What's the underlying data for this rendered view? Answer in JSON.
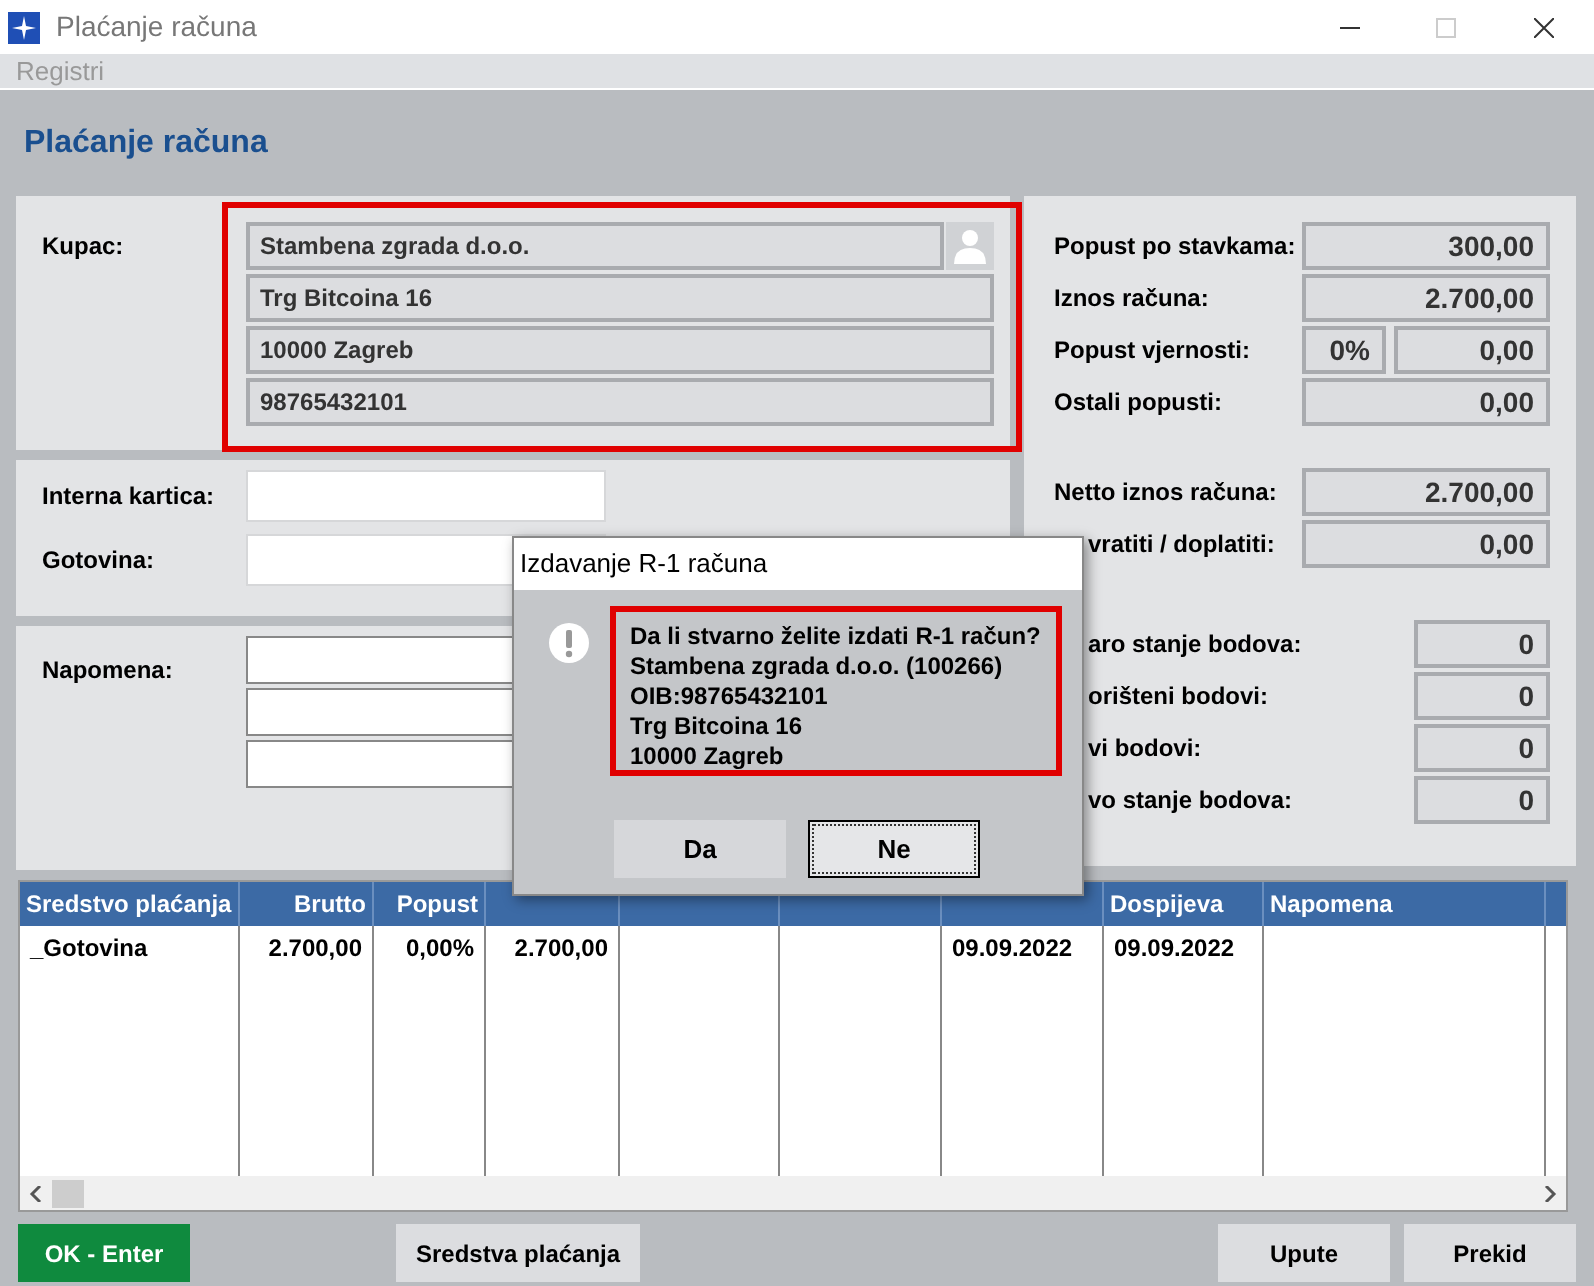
{
  "window": {
    "title": "Plaćanje računa"
  },
  "menu": [
    {
      "label": "Registri",
      "disabled": true
    }
  ],
  "heading": "Plaćanje računa",
  "customer": {
    "label": "Kupac:",
    "highlighted": true,
    "lines": [
      "Stambena zgrada d.o.o.",
      "Trg Bitcoina 16",
      "10000 Zagreb",
      "98765432101"
    ]
  },
  "fields": [
    {
      "label": "Interna kartica:"
    },
    {
      "label": "Gotovina:"
    }
  ],
  "note": {
    "label": "Napomena:"
  },
  "summary": [
    [
      {
        "label": "Popust po stavkama:",
        "value": "300,00"
      },
      {
        "label": "Iznos računa:",
        "value": "2.700,00"
      },
      {
        "label": "Popust vjernosti:",
        "percent": "0%",
        "value": "0,00"
      },
      {
        "label": "Ostali popusti:",
        "value": "0,00"
      }
    ],
    [
      {
        "label": "Netto iznos računa:",
        "value": "2.700,00"
      },
      {
        "label": "vratiti / doplatiti:",
        "value": "0,00"
      }
    ]
  ],
  "points": [
    {
      "label": "aro stanje bodova:",
      "value": "0"
    },
    {
      "label": "orišteni bodovi:",
      "value": "0"
    },
    {
      "label": "vi bodovi:",
      "value": "0"
    },
    {
      "label": "vo stanje bodova:",
      "value": "0"
    }
  ],
  "table": {
    "columns": [
      {
        "label": "Sredstvo plaćanja"
      },
      {
        "label": "Brutto"
      },
      {
        "label": "Popust"
      },
      {},
      {},
      {},
      {},
      {
        "label": "Dospijeva"
      },
      {
        "label": "Napomena"
      }
    ],
    "rows": [
      [
        "_Gotovina",
        "2.700,00",
        "0,00%",
        "2.700,00",
        "",
        "",
        "09.09.2022",
        "09.09.2022",
        ""
      ]
    ]
  },
  "buttons": [
    {
      "label": "OK - Enter",
      "kind": "primary"
    },
    {
      "label": "Sredstva plaćanja",
      "kind": "default"
    },
    {
      "label": "Upute",
      "kind": "default"
    },
    {
      "label": "Prekid",
      "kind": "default"
    }
  ],
  "dialog": {
    "title": "Izdavanje R-1 računa",
    "highlighted": true,
    "lines": [
      "Da li stvarno želite izdati R-1 račun?",
      "Stambena zgrada d.o.o. (100266)",
      "OIB:98765432101",
      "Trg Bitcoina 16",
      "10000 Zagreb"
    ],
    "buttons": [
      {
        "label": "Da",
        "focused": false
      },
      {
        "label": "Ne",
        "focused": true
      }
    ]
  }
}
